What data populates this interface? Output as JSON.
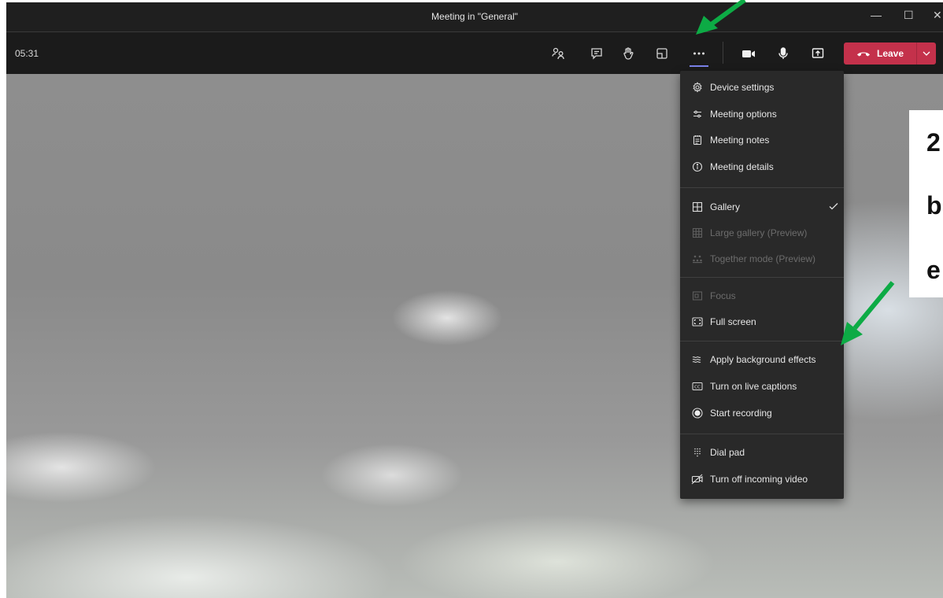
{
  "window": {
    "title": "Meeting in \"General\"",
    "minimize_glyph": "—",
    "maximize_glyph": "☐",
    "close_glyph": "✕"
  },
  "toolbar": {
    "timer": "05:31",
    "leave_label": "Leave",
    "buttons": [
      "people-icon",
      "chat-icon",
      "raise-hand-icon",
      "rooms-icon",
      "more-actions-icon",
      "camera-icon",
      "microphone-icon",
      "share-icon"
    ]
  },
  "menu": {
    "items": [
      {
        "label": "Device settings",
        "icon": "gear-icon",
        "enabled": true
      },
      {
        "label": "Meeting options",
        "icon": "sliders-icon",
        "enabled": true
      },
      {
        "label": "Meeting notes",
        "icon": "notes-icon",
        "enabled": true
      },
      {
        "label": "Meeting details",
        "icon": "info-icon",
        "enabled": true
      },
      {
        "label": "Gallery",
        "icon": "gallery-icon",
        "enabled": true,
        "checked": true
      },
      {
        "label": "Large gallery (Preview)",
        "icon": "large-gallery-icon",
        "enabled": false
      },
      {
        "label": "Together mode (Preview)",
        "icon": "together-mode-icon",
        "enabled": false
      },
      {
        "label": "Focus",
        "icon": "focus-icon",
        "enabled": false
      },
      {
        "label": "Full screen",
        "icon": "fullscreen-icon",
        "enabled": true
      },
      {
        "label": "Apply background effects",
        "icon": "background-effects-icon",
        "enabled": true
      },
      {
        "label": "Turn on live captions",
        "icon": "captions-icon",
        "enabled": true
      },
      {
        "label": "Start recording",
        "icon": "record-icon",
        "enabled": true
      },
      {
        "label": "Dial pad",
        "icon": "dialpad-icon",
        "enabled": true
      },
      {
        "label": "Turn off incoming video",
        "icon": "video-off-icon",
        "enabled": true
      }
    ]
  },
  "annotation": {
    "line1": "2",
    "line2": "b",
    "line3": "e",
    "arrow_color": "#0dab45"
  },
  "colors": {
    "accent": "#7b83eb",
    "leave": "#c4314b",
    "menu_bg": "#292929",
    "toolbar_bg": "#1b1b1b"
  }
}
